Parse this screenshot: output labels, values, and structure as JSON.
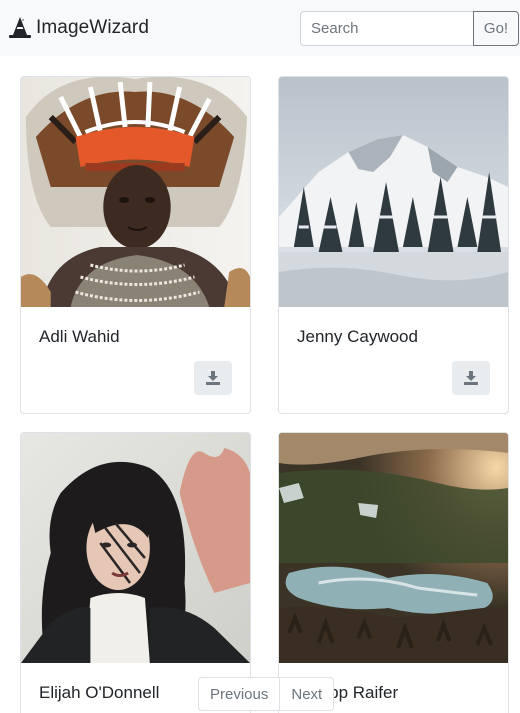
{
  "navbar": {
    "brand": "ImageWizard",
    "search_placeholder": "Search",
    "search_button": "Go!"
  },
  "cards": [
    {
      "author": "Adli Wahid",
      "download_icon": "download-icon"
    },
    {
      "author": "Jenny Caywood",
      "download_icon": "download-icon"
    },
    {
      "author": "Elijah O'Donnell",
      "download_icon": "download-icon"
    },
    {
      "author": "Philipp Raifer",
      "download_icon": "download-icon"
    }
  ],
  "pagination": {
    "previous": "Previous",
    "next": "Next"
  },
  "colors": {
    "navbar_bg": "#f8f9fa",
    "button_bg": "#e9ecef",
    "border": "#dee2e6",
    "text": "#212529",
    "muted": "#6c757d"
  }
}
